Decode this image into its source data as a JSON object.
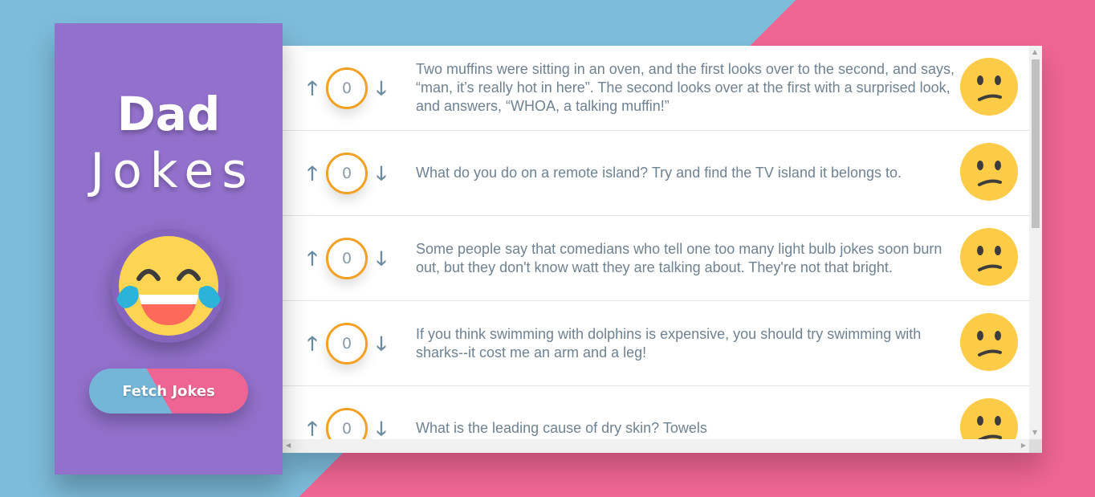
{
  "sidebar": {
    "title_line1": "Dad",
    "title_line2": "Jokes",
    "fetch_button": "Fetch Jokes"
  },
  "jokes": [
    {
      "score": "0",
      "text": "Two muffins were sitting in an oven, and the first looks over to the second, and says, “man, it’s really hot in here”. The second looks over at the first with a surprised look, and answers, “WHOA, a talking muffin!”"
    },
    {
      "score": "0",
      "text": "What do you do on a remote island? Try and find the TV island it belongs to."
    },
    {
      "score": "0",
      "text": "Some people say that comedians who tell one too many light bulb jokes soon burn out, but they don't know watt they are talking about. They're not that bright."
    },
    {
      "score": "0",
      "text": "If you think swimming with dolphins is expensive, you should try swimming with sharks--it cost me an arm and a leg!"
    },
    {
      "score": "0",
      "text": "What is the leading cause of dry skin? Towels"
    }
  ],
  "icons": {
    "upvote": "arrow-up-icon",
    "downvote": "arrow-down-icon",
    "joke_face": "confused-face-icon",
    "logo_face": "laughing-tears-face-icon"
  },
  "colors": {
    "sidebar_bg": "#9271cc",
    "bg_blue": "#7dbcdb",
    "bg_pink": "#ef6593",
    "score_ring": "#f4a023",
    "face_yellow": "#fccb47"
  }
}
